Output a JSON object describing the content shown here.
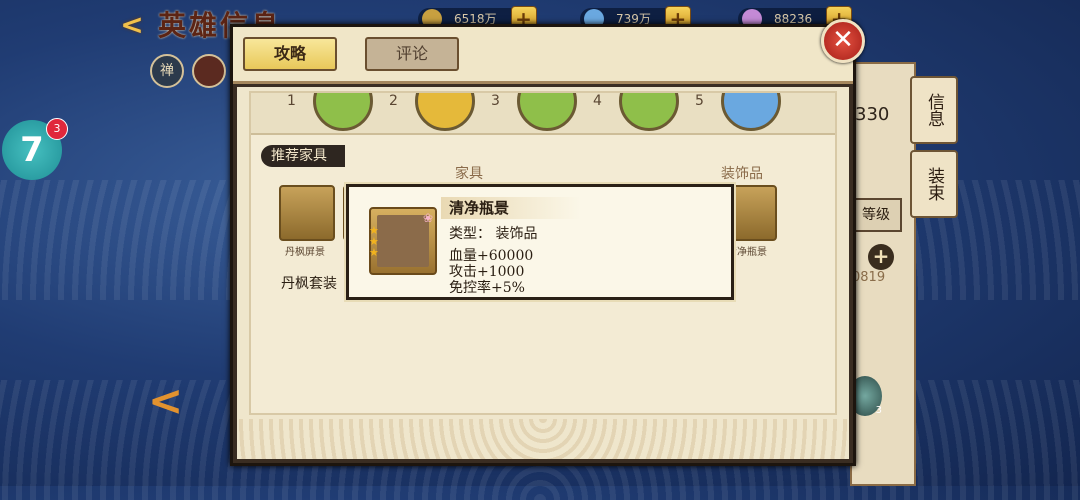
{
  "topbar": {
    "title": "英雄信息",
    "resources": [
      {
        "name": "coin",
        "value": "6518万",
        "color": "#c8a040"
      },
      {
        "name": "currency-2",
        "value": "739万",
        "color": "#6aa8e0"
      },
      {
        "name": "currency-3",
        "value": "88236",
        "color": "#c48ad6"
      }
    ],
    "plus_label": "+",
    "back_label": "<"
  },
  "left": {
    "icon_zen": "禅",
    "icon_seven": "7",
    "seven_badge": "3",
    "chevron": "<"
  },
  "dialog": {
    "tabs": [
      {
        "label": "攻略",
        "active": true
      },
      {
        "label": "评论",
        "active": false
      }
    ],
    "close_label": "✕",
    "medal_numbers": [
      "1",
      "2",
      "3",
      "4",
      "5"
    ],
    "recommend_label": "推荐家具",
    "col_furniture": "家具",
    "col_decoration": "装饰品",
    "item_captions": [
      "丹枫屏景",
      "清净瓶景"
    ],
    "set_text": "丹枫套装"
  },
  "tooltip": {
    "name": "清净瓶景",
    "type_line": "类型：  装饰品",
    "stats": [
      "血量+60000",
      "攻击+1000",
      "免控率+5%"
    ],
    "stars": 3
  },
  "right_panel": {
    "tab_info": "信息",
    "tab_outfit": "装束",
    "value_330": "330",
    "level_label": "等级",
    "value_0819": "0819",
    "shield_count": "3",
    "plus_label": "+"
  }
}
